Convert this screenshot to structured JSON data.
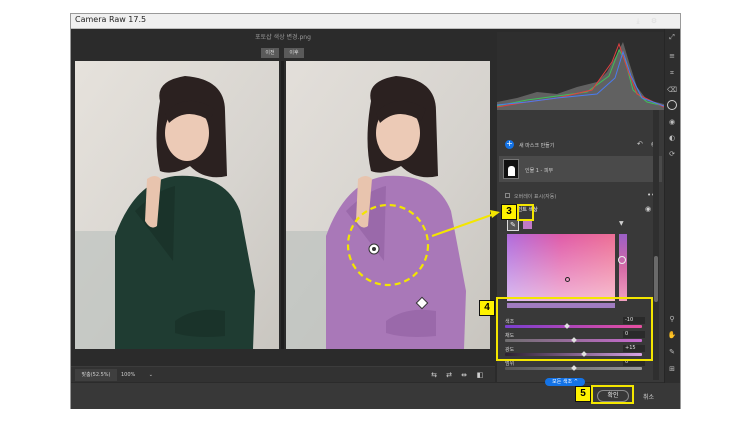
{
  "window": {
    "title": "Camera Raw 17.5"
  },
  "canvas": {
    "filename": "포토샵 색상 변경.png",
    "view_toggle": {
      "before": "이전",
      "after": "이후"
    }
  },
  "bottom_bar": {
    "zoom_fit": "맞춤(52.5%)",
    "zoom_value": "100%",
    "chevron": "⌄"
  },
  "mask_panel": {
    "create_mask": "새 마스크 만들기",
    "mask_item": "인물 1 - 피부",
    "overlay_label": "오버레이 표시(자동)",
    "section_title": "포인트 색상"
  },
  "sliders": [
    {
      "label": "색조",
      "value": "-10",
      "position": 0.45
    },
    {
      "label": "채도",
      "value": "0",
      "position": 0.5
    },
    {
      "label": "광도",
      "value": "+15",
      "position": 0.575
    },
    {
      "label": "범위",
      "value": "0",
      "position": 0.5
    }
  ],
  "more_button": "모든 색조 ^",
  "footer": {
    "ok": "확인",
    "cancel": "취소"
  },
  "callouts": {
    "c3": "3",
    "c4": "4",
    "c5": "5"
  },
  "colors": {
    "accent_blue": "#1473e6",
    "highlight_yellow": "#fff200",
    "sweater_before": "#1f3c32",
    "sweater_after": "#a978b8"
  }
}
